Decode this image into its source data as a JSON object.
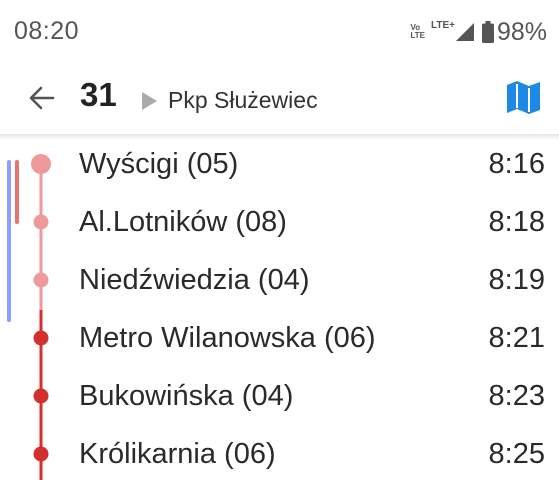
{
  "status_bar": {
    "time": "08:20",
    "volte_top": "Vo",
    "volte_bottom": "LTE",
    "network": "LTE+",
    "battery": "98%"
  },
  "app_bar": {
    "line_number": "31",
    "direction": "Pkp Służewiec",
    "accent_color": "#1e88e5"
  },
  "colors": {
    "passed": "#ef9a9a",
    "upcoming": "#d32f2f",
    "current_marker": "#8c9eff"
  },
  "stops": [
    {
      "name": "Wyścigi (05)",
      "time": "8:16",
      "state": "current"
    },
    {
      "name": "Al.Lotników (08)",
      "time": "8:18",
      "state": "passed"
    },
    {
      "name": "Niedźwiedzia (04)",
      "time": "8:19",
      "state": "passed"
    },
    {
      "name": "Metro Wilanowska (06)",
      "time": "8:21",
      "state": "upcoming"
    },
    {
      "name": "Bukowińska (04)",
      "time": "8:23",
      "state": "upcoming"
    },
    {
      "name": "Królikarnia (06)",
      "time": "8:25",
      "state": "upcoming"
    }
  ]
}
